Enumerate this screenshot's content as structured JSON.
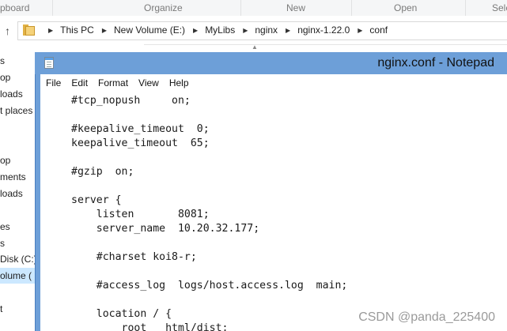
{
  "explorer": {
    "ribbon_groups": [
      "pboard",
      "Organize",
      "New",
      "Open",
      "Sele"
    ],
    "breadcrumb": [
      "This PC",
      "New Volume (E:)",
      "MyLibs",
      "nginx",
      "nginx-1.22.0",
      "conf"
    ],
    "nav_items": [
      "s",
      "op",
      "loads",
      "t places",
      "op",
      "ments",
      "loads",
      "es",
      "s",
      "Disk (C:)",
      "olume (",
      "t"
    ],
    "nav_selected_index": 10
  },
  "notepad": {
    "title": "nginx.conf - Notepad",
    "menu": [
      "File",
      "Edit",
      "Format",
      "View",
      "Help"
    ],
    "lines": [
      "#tcp_nopush     on;",
      "",
      "#keepalive_timeout  0;",
      "keepalive_timeout  65;",
      "",
      "#gzip  on;",
      "",
      "server {",
      "    listen       8081;",
      "    server_name  10.20.32.177;",
      "",
      "    #charset koi8-r;",
      "",
      "    #access_log  logs/host.access.log  main;",
      "",
      "    location / {",
      "        root   html/dist;"
    ]
  },
  "watermark": "CSDN @panda_225400",
  "colors": {
    "titlebar": "#6d9fd8",
    "nav_selected": "#cce8ff",
    "folder": "#f5d27a"
  }
}
